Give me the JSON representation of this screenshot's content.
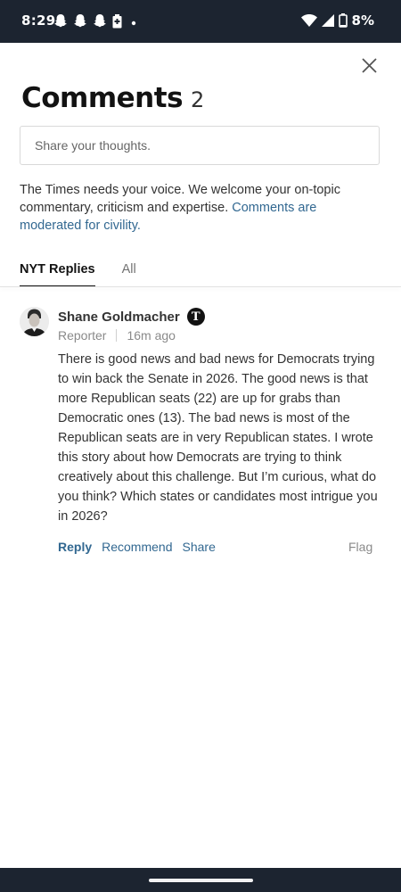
{
  "status_bar": {
    "time": "8:29",
    "battery": "8%",
    "notification_icons": [
      "snapchat-icon",
      "snapchat-icon",
      "snapchat-icon",
      "battery-saver-icon",
      "dot-icon"
    ]
  },
  "header": {
    "title": "Comments",
    "count": "2"
  },
  "composer": {
    "placeholder": "Share your thoughts."
  },
  "intro": {
    "text": "The Times needs your voice. We welcome your on-topic commentary, criticism and expertise. ",
    "link": "Comments are moderated for civility."
  },
  "tabs": [
    {
      "label": "NYT Replies",
      "active": true
    },
    {
      "label": "All",
      "active": false
    }
  ],
  "comment": {
    "author": "Shane Goldmacher",
    "role": "Reporter",
    "time_ago": "16m ago",
    "body": "There is good news and bad news for Democrats trying to win back the Senate in 2026. The good news is that more Republican seats (22) are up for grabs than Democratic ones (13). The bad news is most of the Republican seats are in very Republican states. I wrote this story about how Democrats are trying to think creatively about this challenge. But I’m curious, what do you think? Which states or candidates most intrigue you in 2026?",
    "actions": {
      "reply": "Reply",
      "recommend": "Recommend",
      "share": "Share",
      "flag": "Flag"
    }
  },
  "colors": {
    "link": "#326891",
    "system_bar": "#1c2430"
  }
}
